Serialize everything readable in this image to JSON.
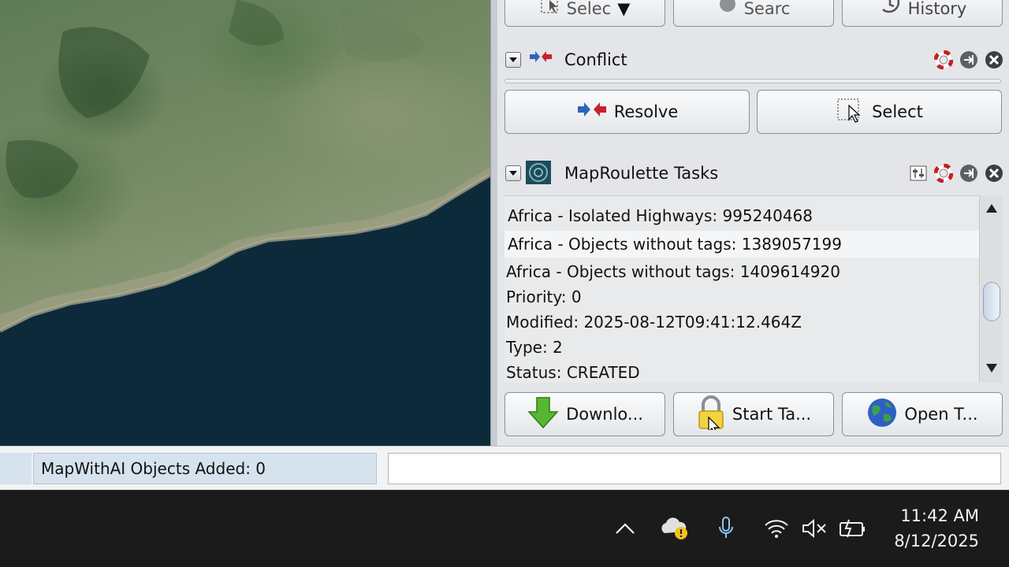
{
  "toolbar": {
    "select_label": "Selec",
    "search_label": "Searc",
    "history_label": "History"
  },
  "conflict_panel": {
    "title": "Conflict",
    "resolve_label": "Resolve",
    "select_label": "Select"
  },
  "maproulette_panel": {
    "title": "MapRoulette Tasks",
    "tasks": [
      "Africa - Isolated Highways: 995240468",
      "Africa - Objects without tags: 1389057199",
      "Africa - Objects without tags: 1409614920"
    ],
    "details": {
      "priority": "Priority: 0",
      "modified": "Modified: 2025-08-12T09:41:12.464Z",
      "type": "Type: 2",
      "status": "Status: CREATED"
    },
    "download_label": "Downlo...",
    "start_label": "Start Ta...",
    "open_label": "Open T..."
  },
  "statusbar": {
    "objects_added": "MapWithAI Objects Added: 0"
  },
  "taskbar": {
    "time": "11:42 AM",
    "date": "8/12/2025"
  },
  "colors": {
    "ocean": "#0d2a3a",
    "panel_bg": "#e3e5e8",
    "selected_row": "#f4f5f6",
    "status_highlight": "#d6e2ee",
    "taskbar_bg": "#1b1b1b"
  }
}
